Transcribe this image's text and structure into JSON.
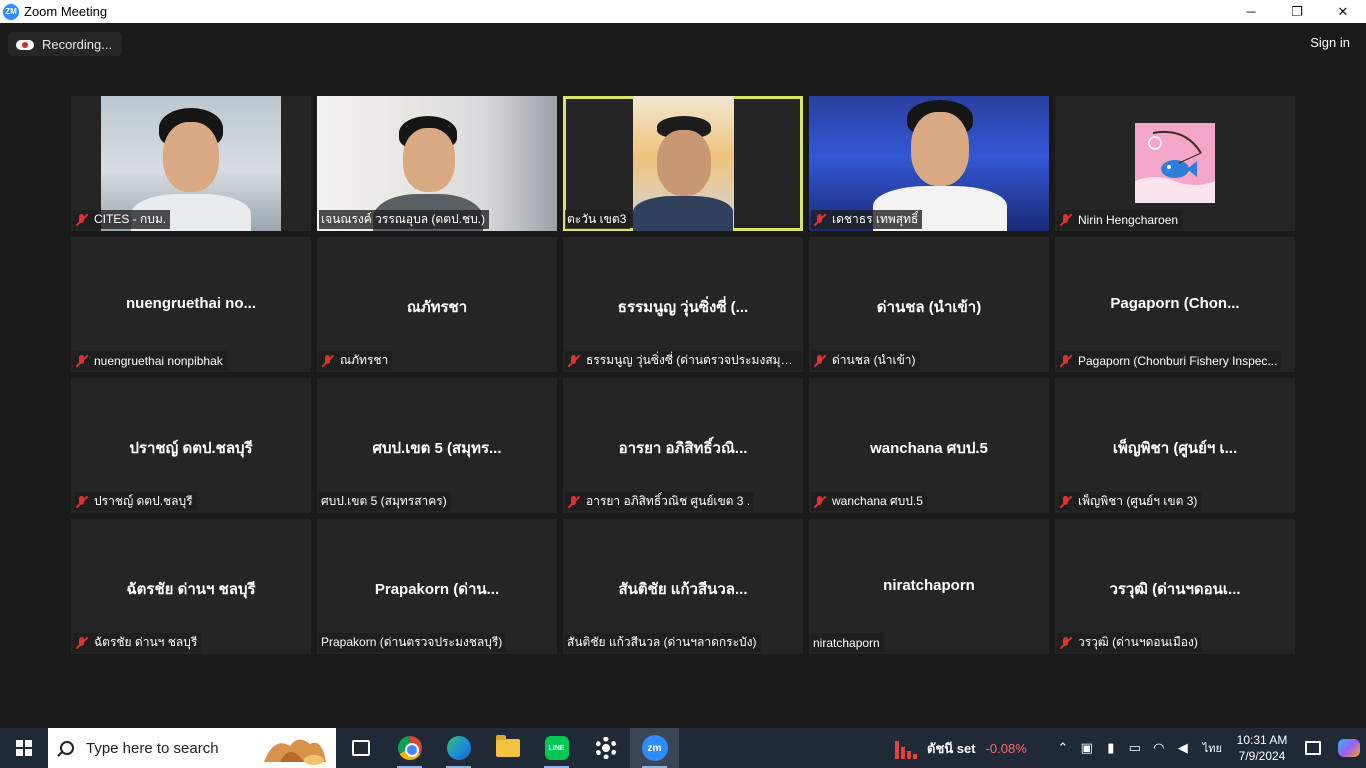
{
  "window": {
    "app_icon": "ZM",
    "title": "Zoom Meeting",
    "controls": [
      "minimize-icon",
      "restore-icon",
      "close-icon"
    ]
  },
  "top_bar": {
    "recording_label": "Recording...",
    "sign_in_label": "Sign in"
  },
  "participants": [
    {
      "name": "CITES - กบม.",
      "muted": true,
      "video": true,
      "active_speaker": false
    },
    {
      "name": "เจนณรงค์ วรรณอุบล (ดตป.ชบ.)",
      "muted": false,
      "video": true,
      "active_speaker": false
    },
    {
      "name": "ตะวัน เขต3",
      "muted": false,
      "video": true,
      "active_speaker": true
    },
    {
      "name": "เดชาธร เทพสุทธิ์",
      "muted": true,
      "video": true,
      "active_speaker": false
    },
    {
      "name": "Nirin Hengcharoen",
      "muted": true,
      "video": false,
      "avatar": true,
      "active_speaker": false
    },
    {
      "name": "nuengruethai nonpibhak",
      "display": "nuengruethai  no...",
      "muted": true,
      "video": false
    },
    {
      "name": "ณภัทรชา",
      "display": "ณภัทรชา",
      "muted": true,
      "video": false
    },
    {
      "name": "ธรรมนูญ วุ่นซิ่งซี่ (ด่านตรวจประมงสมุทรส...",
      "display": "ธรรมนูญ วุ่นซิ่งซี่ (...",
      "muted": true,
      "video": false
    },
    {
      "name": "ด่านชล (นำเข้า)",
      "display": "ด่านชล (นำเข้า)",
      "muted": true,
      "video": false
    },
    {
      "name": "Pagaporn (Chonburi Fishery Inspec...",
      "display": "Pagaporn  (Chon...",
      "muted": true,
      "video": false
    },
    {
      "name": "ปราชญ์ ดตป.ชลบุรี",
      "display": "ปราชญ์ ดตป.ชลบุรี",
      "muted": true,
      "video": false
    },
    {
      "name": "ศบป.เขต 5 (สมุทรสาคร)",
      "display": "ศบป.เขต 5 (สมุทร...",
      "muted": false,
      "video": false
    },
    {
      "name": "อารยา อภิสิทธิ์วณิช ศูนย์เขต 3 .",
      "display": "อารยา อภิสิทธิ์วณิ...",
      "muted": true,
      "video": false
    },
    {
      "name": "wanchana ศบป.5",
      "display": "wanchana ศบป.5",
      "muted": true,
      "video": false
    },
    {
      "name": "เพ็ญพิชา (ศูนย์ฯ เขต 3)",
      "display": "เพ็ญพิชา (ศูนย์ฯ เ...",
      "muted": true,
      "video": false
    },
    {
      "name": "ฉัตรชัย ด่านฯ ชลบุรี",
      "display": "ฉัตรชัย ด่านฯ ชลบุรี",
      "muted": true,
      "video": false
    },
    {
      "name": "Prapakorn (ด่านตรวจประมงชลบุรี)",
      "display": "Prapakorn  (ด่าน...",
      "muted": false,
      "video": false
    },
    {
      "name": "สันติชัย แก้วสีนวล (ด่านฯลาดกระบัง)",
      "display": "สันติชัย แก้วสีนวล...",
      "muted": false,
      "video": false
    },
    {
      "name": "niratchaporn",
      "display": "niratchaporn",
      "muted": false,
      "video": false
    },
    {
      "name": "วรวุฒิ (ด่านฯดอนเมือง)",
      "display": "วรวุฒิ (ด่านฯดอนเ...",
      "muted": true,
      "video": false
    }
  ],
  "taskbar": {
    "search_placeholder": "Type here to search",
    "apps": [
      {
        "name": "task-view-icon",
        "running": false
      },
      {
        "name": "chrome-icon",
        "running": true
      },
      {
        "name": "edge-icon",
        "running": true
      },
      {
        "name": "file-explorer-icon",
        "running": false
      },
      {
        "name": "line-icon",
        "running": true,
        "label": "LINE"
      },
      {
        "name": "settings-icon",
        "running": false
      },
      {
        "name": "zoom-icon",
        "running": true,
        "label": "zm"
      }
    ],
    "stock": {
      "label": "ดัชนี set",
      "change": "-0.08%"
    },
    "language": "ไทย",
    "time": "10:31 AM",
    "date": "7/9/2024"
  },
  "colors": {
    "background": "#1a1a1a",
    "tile": "#252525",
    "active_speaker_border": "#d9e36a",
    "muted": "#e03131",
    "taskbar": "#1f2a36",
    "zoom_blue": "#2d8cff"
  }
}
